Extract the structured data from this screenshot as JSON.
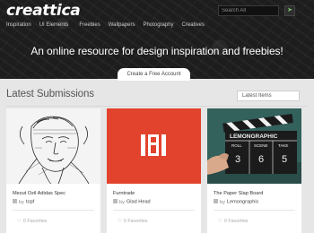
{
  "header": {
    "logo": "creattica",
    "search_placeholder": "Search All",
    "nav": [
      "Inspiration",
      "UI Elements",
      "Freebies",
      "Wallpapers",
      "Photography",
      "Creatives"
    ],
    "tagline": "An online resource for design inspiration and freebies!",
    "cta": "Create a Free Account"
  },
  "main": {
    "title": "Latest Submissions",
    "filter": "Latest Items",
    "cards": [
      {
        "title": "Mesut Ozil Adidas Spec",
        "author": "topf",
        "favorites": "0 Favorites"
      },
      {
        "title": "Furntrade",
        "author": "Glad Head",
        "favorites": "0 Favorites"
      },
      {
        "title": "The Paper Slap Board",
        "author": "Lemongraphic",
        "favorites": "0 Favorites"
      }
    ],
    "by": "by"
  },
  "slate": {
    "brand": "LEMONGRAPHIC",
    "roll_label": "ROLL",
    "scene_label": "SCENE",
    "take_label": "TAKE",
    "roll": "3",
    "scene": "6",
    "take": "5"
  },
  "colors": {
    "hero_bg": "#1d1d1d",
    "page_bg": "#e6e6e6",
    "card2_bg": "#e2432c",
    "accent_green": "#7cc06e"
  }
}
